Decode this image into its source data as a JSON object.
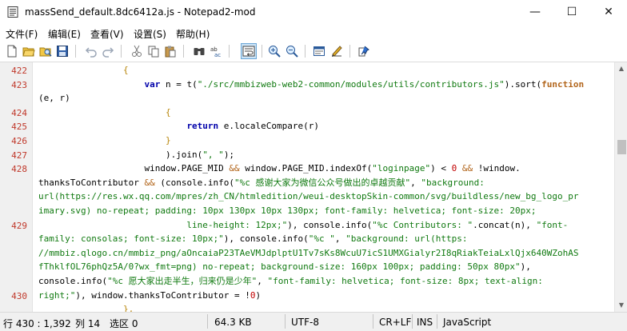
{
  "window": {
    "title": "massSend_default.8dc6412a.js - Notepad2-mod",
    "minimize_glyph": "—",
    "maximize_glyph": "☐",
    "close_glyph": "✕"
  },
  "menu": [
    "文件(F)",
    "编辑(E)",
    "查看(V)",
    "设置(S)",
    "帮助(H)"
  ],
  "toolbar": {
    "icons": [
      "new-file-icon",
      "open-icon",
      "browse-icon",
      "save-icon",
      "undo-icon",
      "redo-icon",
      "cut-icon",
      "copy-icon",
      "paste-icon",
      "find-icon",
      "replace-icon",
      "word-wrap-icon",
      "zoom-in-icon",
      "zoom-out-icon",
      "schemes-icon",
      "customize-schemes-icon",
      "always-on-top-icon"
    ],
    "active": "word-wrap-icon"
  },
  "editor": {
    "line_numbers": [
      {
        "n": "422",
        "row": 0
      },
      {
        "n": "423",
        "row": 1
      },
      {
        "n": "424",
        "row": 3
      },
      {
        "n": "425",
        "row": 4
      },
      {
        "n": "426",
        "row": 5
      },
      {
        "n": "427",
        "row": 6
      },
      {
        "n": "428",
        "row": 7
      },
      {
        "n": "429",
        "row": 11
      },
      {
        "n": "430",
        "row": 16
      }
    ],
    "rows": [
      [
        {
          "t": "                {",
          "c": "brace"
        }
      ],
      [
        {
          "t": "                    "
        },
        {
          "t": "var",
          "c": "kwb"
        },
        {
          "t": " n = t("
        },
        {
          "t": "\"./src/mmbizweb-web2-common/modules/utils/contributors.js\"",
          "c": "str"
        },
        {
          "t": ").sort("
        },
        {
          "t": "function",
          "c": "kw"
        }
      ],
      [
        {
          "t": "(e, r)"
        }
      ],
      [
        {
          "t": "                        {",
          "c": "brace"
        }
      ],
      [
        {
          "t": "                            "
        },
        {
          "t": "return",
          "c": "kwb"
        },
        {
          "t": " e.localeCompare(r)"
        }
      ],
      [
        {
          "t": "                        }",
          "c": "brace"
        }
      ],
      [
        {
          "t": "                        ).join("
        },
        {
          "t": "\", \"",
          "c": "str"
        },
        {
          "t": ");"
        }
      ],
      [
        {
          "t": "                    window.PAGE_MID "
        },
        {
          "t": "&&",
          "c": "op"
        },
        {
          "t": " window.PAGE_MID.indexOf("
        },
        {
          "t": "\"loginpage\"",
          "c": "str"
        },
        {
          "t": ") < "
        },
        {
          "t": "0",
          "c": "num"
        },
        {
          "t": " "
        },
        {
          "t": "&&",
          "c": "op"
        },
        {
          "t": " !window."
        }
      ],
      [
        {
          "t": "thanksToContributor "
        },
        {
          "t": "&&",
          "c": "op"
        },
        {
          "t": " (console.info("
        },
        {
          "t": "\"%c 感谢大家为微信公众号做出的卓越贡献\"",
          "c": "str"
        },
        {
          "t": ", "
        },
        {
          "t": "\"background:",
          "c": "str"
        }
      ],
      [
        {
          "t": "url(https://res.wx.qq.com/mpres/zh_CN/htmledition/weui-desktopSkin-common/svg/buildless/new_bg_logo_pr",
          "c": "str"
        }
      ],
      [
        {
          "t": "imary.svg) no-repeat; padding: 10px 130px 10px 130px; font-family: helvetica; font-size: 20px;",
          "c": "str"
        }
      ],
      [
        {
          "t": "                            line-height: 12px;\"",
          "c": "str"
        },
        {
          "t": "), console.info("
        },
        {
          "t": "\"%c Contributors: \"",
          "c": "str"
        },
        {
          "t": ".concat(n), "
        },
        {
          "t": "\"font-",
          "c": "str"
        }
      ],
      [
        {
          "t": "family: consolas; font-size: 10px;\"",
          "c": "str"
        },
        {
          "t": "), console.info("
        },
        {
          "t": "\"%c \"",
          "c": "str"
        },
        {
          "t": ", "
        },
        {
          "t": "\"background: url(https:",
          "c": "str"
        }
      ],
      [
        {
          "t": "//mmbiz.qlogo.cn/mmbiz_png/aOncaiaP23TAeVMJdplptU1Tv7sKs8WcuU7icS1UMXGialyr2I8qRiakTeiaLxlQjx640WZohAS",
          "c": "str"
        }
      ],
      [
        {
          "t": "fThklfOL76phQz5A/0?wx_fmt=png) no-repeat; background-size: 160px 100px; padding: 50px 80px\"",
          "c": "str"
        },
        {
          "t": "),"
        }
      ],
      [
        {
          "t": "console.info("
        },
        {
          "t": "\"%c 愿大家出走半生，归来仍是少年\"",
          "c": "str"
        },
        {
          "t": ", "
        },
        {
          "t": "\"font-family: helvetica; font-size: 8px; text-align:",
          "c": "str"
        }
      ],
      [
        {
          "t": "right;\"",
          "c": "str"
        },
        {
          "t": "), window.thanksToContributor = !"
        },
        {
          "t": "0",
          "c": "num"
        },
        {
          "t": ")"
        }
      ],
      [
        {
          "t": "                },",
          "c": "brace"
        }
      ],
      [
        {
          "t": "                    \" /  /  /  /  /  /  /  /  /  /  /  /  /  /  /  /  /  /  /  /  /  /  / \"",
          "c": "str"
        }
      ]
    ]
  },
  "status": {
    "position": "行 430 : 1,392",
    "column": "列 14",
    "selection": "选区 0",
    "size": "64.3 KB",
    "encoding": "UTF-8",
    "eol": "CR+LF",
    "mode": "INS",
    "lexer": "JavaScript"
  },
  "colors": {
    "keyword": "#b2651b",
    "string": "#117a11",
    "number": "#c00000",
    "line_number": "#c0392b"
  }
}
